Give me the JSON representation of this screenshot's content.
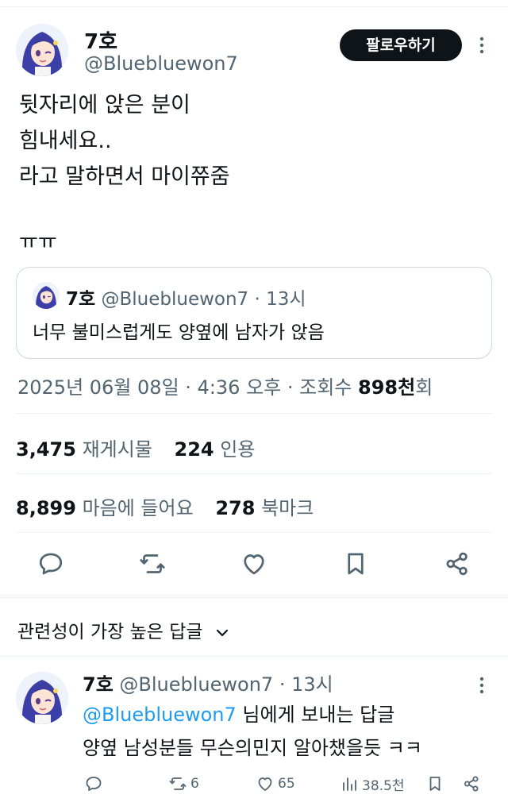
{
  "author": {
    "display_name": "7호",
    "handle": "@Bluebluewon7",
    "avatar_icon": "anime-avatar-icon"
  },
  "follow_label": "팔로우하기",
  "tweet": {
    "lines": [
      "뒷자리에 앉은 분이",
      "힘내세요..",
      "라고 말하면서 마이쮸줌"
    ],
    "emote": "ㅠㅠ"
  },
  "quote": {
    "name": "7호",
    "meta": "@Bluebluewon7 · 13시",
    "text": "너무 불미스럽게도 양옆에 남자가 앉음"
  },
  "meta": {
    "timestamp": "2025년 06월 08일 · 4:36 오후 · 조회수",
    "views": "898천",
    "views_suffix": "회"
  },
  "stats": {
    "retweets": "3,475",
    "retweets_label": "재게시물",
    "quotes": "224",
    "quotes_label": "인용",
    "likes": "8,899",
    "likes_label": "마음에 들어요",
    "bookmarks": "278",
    "bookmarks_label": "북마크"
  },
  "actions": [
    "reply-icon",
    "retweet-icon",
    "like-icon",
    "bookmark-icon",
    "share-icon"
  ],
  "replies_sort_label": "관련성이 가장 높은 답글",
  "reply": {
    "name": "7호",
    "meta": "@Bluebluewon7 · 13시",
    "replying_to_mention": "@Bluebluewon7",
    "replying_to_suffix": " 님에게 보내는 답글",
    "text": "양옆 남성분들 무슨의민지 알아챘을듯 ㅋㅋ",
    "retweet_count": "6",
    "like_count": "65",
    "view_count": "38.5천"
  },
  "colors": {
    "text": "#0f1419",
    "secondary": "#536471",
    "accent": "#1d9bf0",
    "follow_bg": "#0f1419"
  }
}
